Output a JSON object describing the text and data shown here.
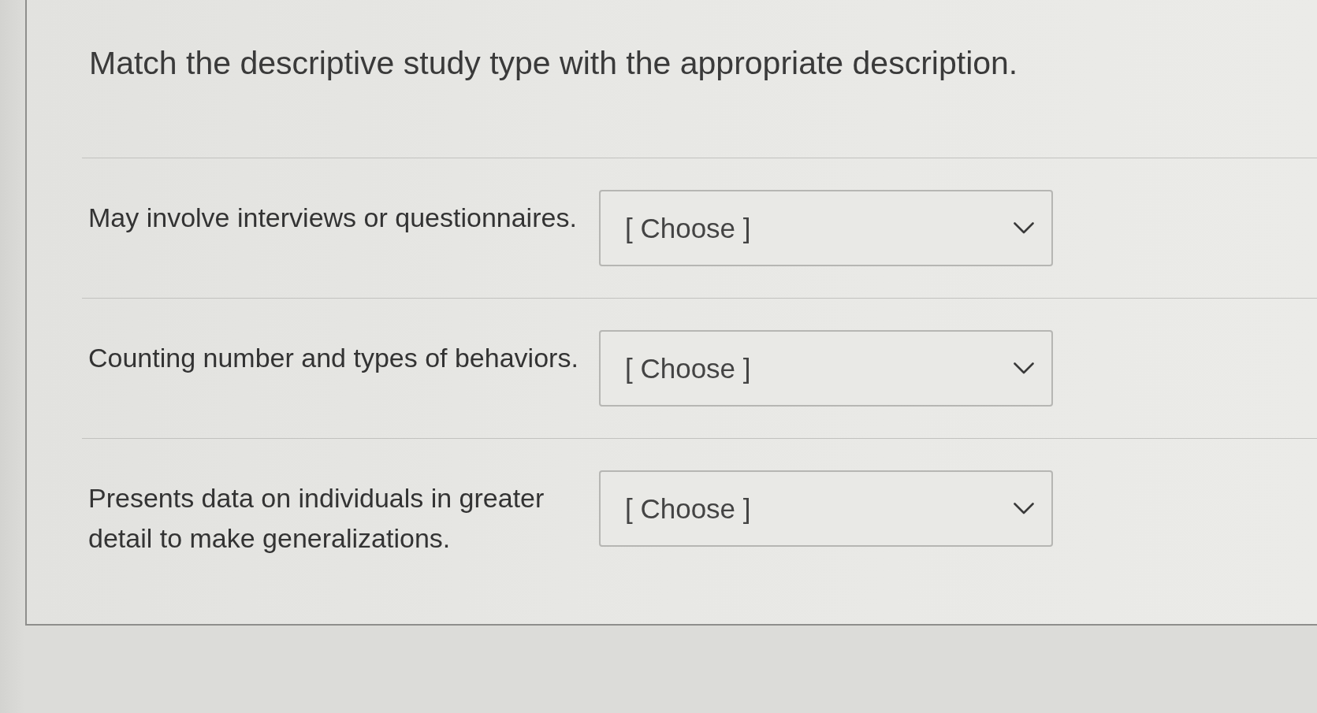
{
  "question": {
    "prompt": "Match the descriptive study type with the appropriate description."
  },
  "matches": [
    {
      "description": "May involve interviews or questionnaires.",
      "answer": {
        "value": "[ Choose ]"
      }
    },
    {
      "description": "Counting number and types of behaviors.",
      "answer": {
        "value": "[ Choose ]"
      }
    },
    {
      "description": "Presents data on individuals in greater detail to make generalizations.",
      "answer": {
        "value": "[ Choose ]"
      }
    }
  ]
}
